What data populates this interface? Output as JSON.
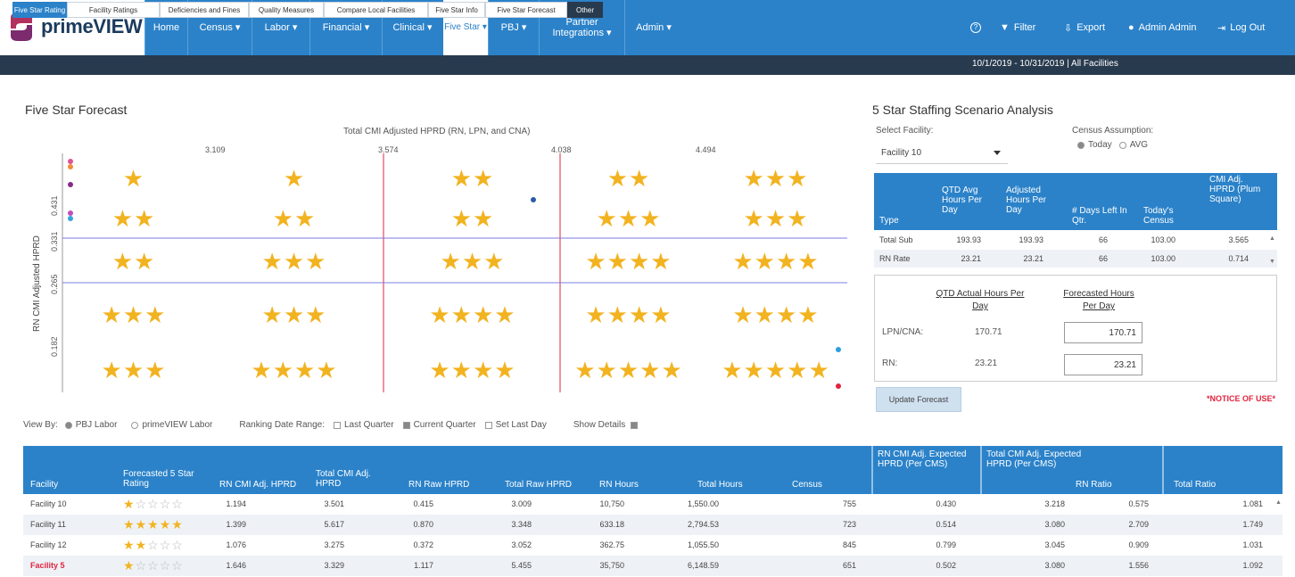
{
  "app": {
    "logo_text": "primeVIEW"
  },
  "nav": {
    "items": [
      {
        "label": "Home"
      },
      {
        "label": "Census ▾"
      },
      {
        "label": "Labor ▾"
      },
      {
        "label": "Financial ▾"
      },
      {
        "label": "Clinical ▾"
      },
      {
        "label": "Five Star ▾"
      },
      {
        "label": "PBJ ▾"
      },
      {
        "label": "Partner Integrations ▾"
      },
      {
        "label": "Admin ▾"
      }
    ],
    "right": {
      "help": "?",
      "filter": "Filter",
      "export": "Export",
      "user": "Admin Admin",
      "logout": "Log Out"
    }
  },
  "subnav": {
    "tabs": [
      "Five Star Rating",
      "Facility Ratings",
      "Deficiencies and Fines",
      "Quality Measures",
      "Compare Local Facilities",
      "Five Star Info",
      "Five Star Forecast",
      "Other"
    ],
    "date_range": "10/1/2019 - 10/31/2019 | All Facilities"
  },
  "forecast": {
    "title": "Five Star Forecast",
    "chart_title": "Total CMI Adjusted HPRD (RN, LPN, and CNA)",
    "x_ticks": [
      "3.109",
      "3.574",
      "4.038",
      "4.494"
    ],
    "y_ticks": [
      "0.431",
      "0.331",
      "0.265",
      "0.182"
    ],
    "y_label": "RN CMI Adjusted HPRD",
    "grid": [
      [
        1,
        1,
        2,
        2,
        3
      ],
      [
        2,
        2,
        2,
        3,
        3
      ],
      [
        2,
        3,
        3,
        4,
        4
      ],
      [
        3,
        3,
        4,
        4,
        4
      ],
      [
        3,
        4,
        4,
        5,
        5
      ]
    ]
  },
  "options": {
    "view_by_label": "View By:",
    "view_pbj": "PBJ Labor",
    "view_prime": "primeVIEW Labor",
    "ranking_label": "Ranking Date Range:",
    "last_quarter": "Last Quarter",
    "current_quarter": "Current Quarter",
    "set_last_day": "Set Last Day",
    "show_details": "Show Details"
  },
  "facility_table": {
    "headers": [
      "Facility",
      "Forecasted 5 Star Rating",
      "RN CMI Adj. HPRD",
      "Total CMI Adj. HPRD",
      "RN Raw HPRD",
      "Total Raw HPRD",
      "RN Hours",
      "Total Hours",
      "Census",
      "RN CMI Adj. Expected HPRD (Per CMS)",
      "Total CMI Adj. Expected HPRD (Per CMS)",
      "RN Ratio",
      "Total Ratio"
    ],
    "rows": [
      {
        "name": "Facility 10",
        "stars": 1,
        "rn_cmi": "1.194",
        "total_cmi": "3.501",
        "rn_raw": "0.415",
        "total_raw": "3.009",
        "rn_hours": "10,750",
        "total_hours": "1,550.00",
        "census": "755",
        "rn_exp": "0.430",
        "total_exp": "3.218",
        "rn_ratio": "0.575",
        "total_ratio": "1.081"
      },
      {
        "name": "Facility 11",
        "stars": 5,
        "rn_cmi": "1.399",
        "total_cmi": "5.617",
        "rn_raw": "0.870",
        "total_raw": "3.348",
        "rn_hours": "633.18",
        "total_hours": "2,794.53",
        "census": "723",
        "rn_exp": "0.514",
        "total_exp": "3.080",
        "rn_ratio": "2.709",
        "total_ratio": "1.749"
      },
      {
        "name": "Facility 12",
        "stars": 2,
        "rn_cmi": "1.076",
        "total_cmi": "3.275",
        "rn_raw": "0.372",
        "total_raw": "3.052",
        "rn_hours": "362.75",
        "total_hours": "1,055.50",
        "census": "845",
        "rn_exp": "0.799",
        "total_exp": "3.045",
        "rn_ratio": "0.909",
        "total_ratio": "1.031"
      },
      {
        "name": "Facility 5",
        "stars": 1,
        "rn_cmi": "1.646",
        "total_cmi": "3.329",
        "rn_raw": "1.117",
        "total_raw": "5.455",
        "rn_hours": "35,750",
        "total_hours": "6,148.59",
        "census": "651",
        "rn_exp": "0.502",
        "total_exp": "3.080",
        "rn_ratio": "1.556",
        "total_ratio": "1.092"
      }
    ]
  },
  "staffing": {
    "title": "5 Star Staffing Scenario Analysis",
    "select_label": "Select Facility:",
    "selected_facility": "Facility 10",
    "census_label": "Census Assumption:",
    "census_today": "Today",
    "census_avg": "AVG",
    "headers": [
      "Type",
      "QTD Avg Hours Per Day",
      "Adjusted Hours Per Day",
      "# Days Left In Qtr.",
      "Today's Census",
      "CMI Adj. HPRD (Plum Square)"
    ],
    "rows": [
      {
        "type": "Total Sub",
        "qtd": "193.93",
        "adj": "193.93",
        "days": "66",
        "census": "103.00",
        "cmi": "3.565"
      },
      {
        "type": "RN Rate",
        "qtd": "23.21",
        "adj": "23.21",
        "days": "66",
        "census": "103.00",
        "cmi": "0.714"
      }
    ],
    "qtd_actual_label": "QTD Actual Hours Per Day",
    "forecast_label": "Forecasted Hours Per Day",
    "lpn_label": "LPN/CNA:",
    "lpn_actual": "170.71",
    "lpn_forecast": "170.71",
    "rn_label": "RN:",
    "rn_actual": "23.21",
    "rn_forecast": "23.21",
    "update_button": "Update Forecast",
    "notice": "*NOTICE OF USE*"
  },
  "colors": {
    "accent": "#2b82c9",
    "dark": "#283a4e",
    "star": "#f2b320",
    "warn": "#e0243d"
  }
}
